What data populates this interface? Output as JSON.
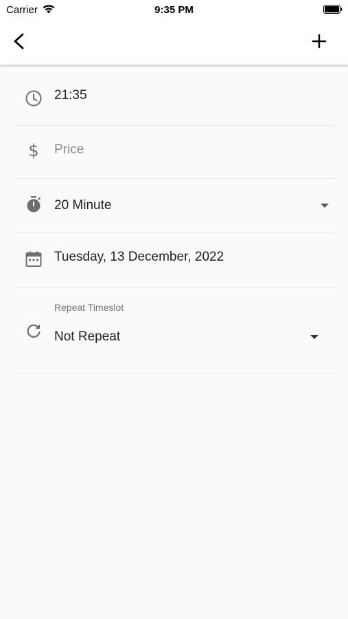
{
  "status_bar": {
    "carrier": "Carrier",
    "time": "9:35 PM"
  },
  "app_bar": {
    "back_icon": "chevron-left-icon",
    "add_icon": "plus-icon"
  },
  "form": {
    "time": {
      "icon": "clock-icon",
      "value": "21:35"
    },
    "price": {
      "icon": "dollar-icon",
      "placeholder": "Price"
    },
    "duration": {
      "icon": "stopwatch-icon",
      "value": "20 Minute"
    },
    "date": {
      "icon": "calendar-icon",
      "value": "Tuesday, 13 December, 2022"
    },
    "repeat": {
      "icon": "refresh-icon",
      "label": "Repeat Timeslot",
      "value": "Not Repeat"
    }
  }
}
